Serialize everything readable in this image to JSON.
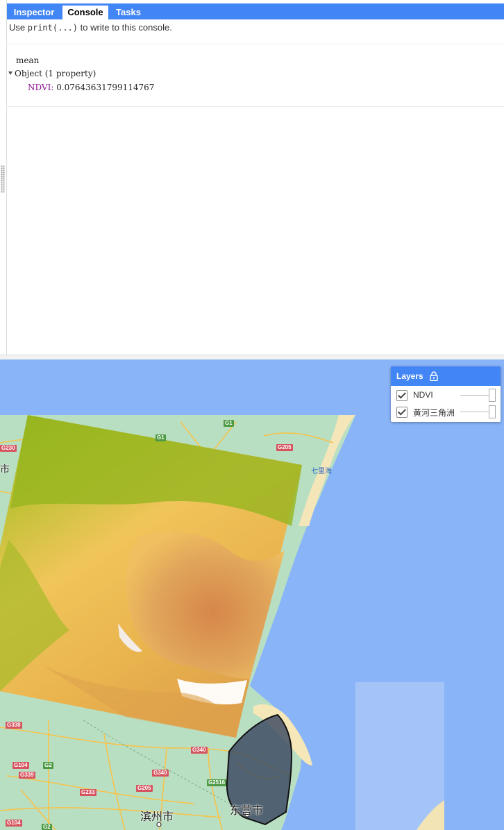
{
  "tabs": [
    {
      "label": "Inspector",
      "active": false
    },
    {
      "label": "Console",
      "active": true
    },
    {
      "label": "Tasks",
      "active": false
    }
  ],
  "console": {
    "hint_prefix": "Use",
    "hint_code": "print(...)",
    "hint_suffix": "to write to this console.",
    "output_name": "mean",
    "object_summary": "Object (1 property)",
    "property_key": "NDVI:",
    "property_value": "0.07643631799114767"
  },
  "map": {
    "layers_title": "Layers",
    "layers": [
      {
        "name": "NDVI",
        "checked": true
      },
      {
        "name": "黄河三角洲",
        "checked": true
      }
    ],
    "road_shields": [
      "G230",
      "G1",
      "G1",
      "G205",
      "G338",
      "G104",
      "G2",
      "G339",
      "G340",
      "G233",
      "G205",
      "G340",
      "G2516",
      "G104",
      "G2"
    ],
    "labels": {
      "left_city_fragment": "市",
      "sea_area": "七里海",
      "city_binzhou": "滨州市",
      "city_dongying": "东营市"
    },
    "colors": {
      "water": "#8ab4f8",
      "land": "#b7dfc0",
      "ndvi_low": "#d18a3f",
      "ndvi_mid": "#f3c85c",
      "ndvi_high": "#7fae14",
      "accent": "#4285f4"
    }
  }
}
